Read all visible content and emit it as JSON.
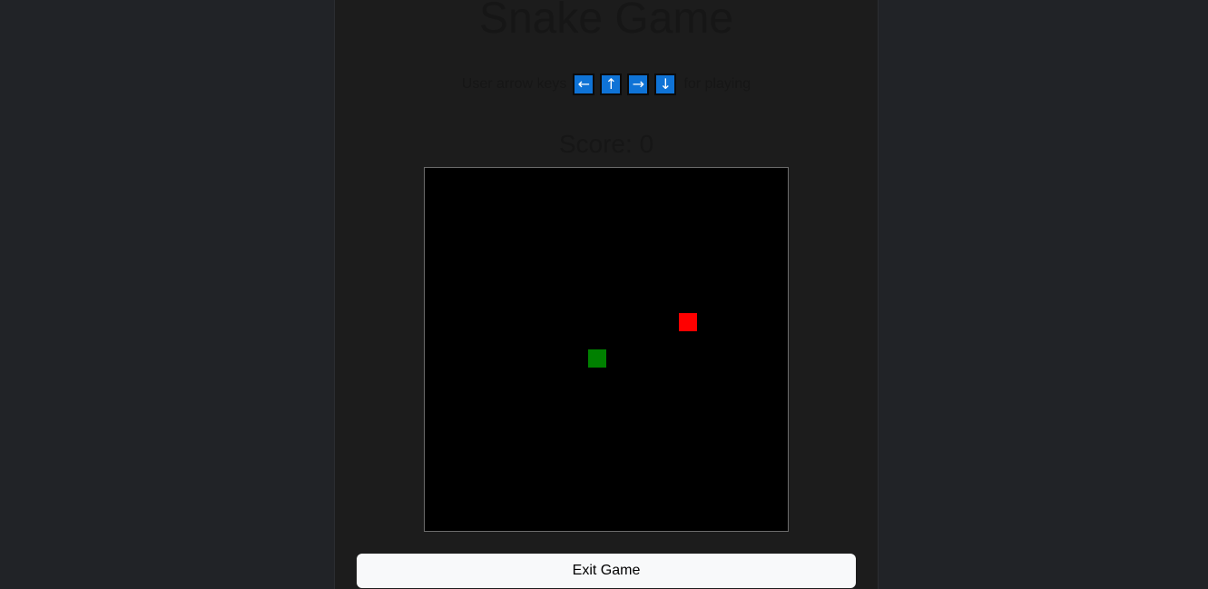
{
  "page": {
    "title": "Snake Game"
  },
  "instructions": {
    "prefix": "User arrow keys",
    "suffix": "for playing",
    "keys": [
      {
        "glyph": "←",
        "icon": "arrow-left-icon"
      },
      {
        "glyph": "↑",
        "icon": "arrow-up-icon"
      },
      {
        "glyph": "→",
        "icon": "arrow-right-icon"
      },
      {
        "glyph": "↓",
        "icon": "arrow-down-icon"
      }
    ],
    "key_color": "#0f73d6"
  },
  "score": {
    "text": "Score: 0"
  },
  "game": {
    "grid_columns": 20,
    "grid_rows": 20,
    "snake": [
      {
        "col": 9,
        "row": 10
      }
    ],
    "food": {
      "col": 14,
      "row": 8
    },
    "snake_color": "#008000",
    "food_color": "#ff0000",
    "board_color": "#000000"
  },
  "controls": {
    "exit_label": "Exit Game"
  }
}
